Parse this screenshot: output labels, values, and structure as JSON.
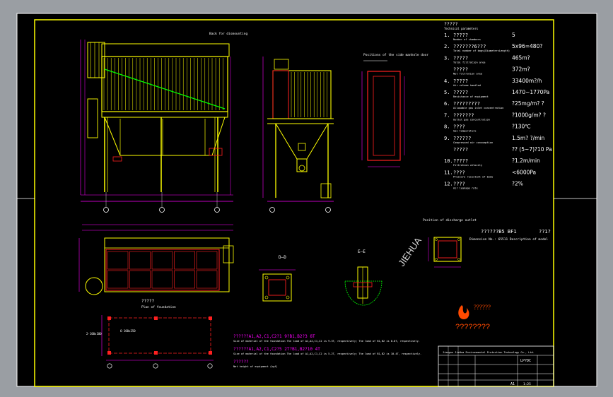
{
  "spec_title": "?????",
  "spec_sub": "Technical parameters",
  "params": [
    {
      "num": "1.",
      "label": "?????",
      "sub": "Number of chambers",
      "value": "5"
    },
    {
      "num": "2.",
      "label": "???????6???",
      "sub": "Total number of bags(Diameter×Length)",
      "value": "5x96=480?"
    },
    {
      "num": "3.",
      "label": "?????",
      "sub": "Total filtration area",
      "value": "465m?"
    },
    {
      "num": "",
      "label": "?????",
      "sub": "Net filtration area",
      "value": "372m?"
    },
    {
      "num": "4.",
      "label": "?????",
      "sub": "Air volume handled",
      "value": "33400m?/h"
    },
    {
      "num": "5.",
      "label": "?????",
      "sub": "Resistance of equipment",
      "value": "1470~1770Pa"
    },
    {
      "num": "6.",
      "label": "?????????",
      "sub": "Allowable gas inlet concentration",
      "value": "?25mg/m? ?"
    },
    {
      "num": "7.",
      "label": "???????",
      "sub": "Outlet gas concentration",
      "value": "?1000g/m? ?"
    },
    {
      "num": "8.",
      "label": "????",
      "sub": "Gas temperature",
      "value": "?130℃"
    },
    {
      "num": "9.",
      "label": "??????",
      "sub": "Compressed air consumption",
      "value": "1.5m? ?/min"
    },
    {
      "num": "",
      "label": "?????",
      "sub": "",
      "value": "??    (5~7)?10   Pa"
    },
    {
      "num": "10.",
      "label": "?????",
      "sub": "Filtration velocity",
      "value": "?1.2m/min"
    },
    {
      "num": "11.",
      "label": "????",
      "sub": "Pressure resistant of body",
      "value": "<6000Pa"
    },
    {
      "num": "12.",
      "label": "????",
      "sub": "Air leakage rate",
      "value": "?2%"
    }
  ],
  "top_label": "Back  for  dismounting",
  "side_label": "Positions of the side manhole door",
  "plan_label": "?????",
  "plan_sub": "Plan of foundation",
  "discharge_label": "Position of discharge outlet",
  "view_label_dd": "D–D",
  "view_label_ee": "E–E",
  "watermark": "JIEHUA",
  "model_line": "??????B5 BF1",
  "model_line2": "Dimension No.: 65511     Description of model",
  "model_right": "??1?",
  "note1": "??????A1,A2,C1,C2?1 9?B1,B2?3 8T",
  "note1_sub": "Size of material of the foundation  The load of A1,A2,C1,C2 is 9.3T, respectively; The load of B1,B2 is 8.8T, respectively.",
  "note2": "??????A1,A2,C1,C2?5 2T?B1,B2?10 4T",
  "note2_sub": "Size of material of the foundation  The load of A1,A2,C1,C2 is 5.2T, respectively; The load of B1,B2 is 10.4T, respectively.",
  "note3": "??????",
  "note3_sub": "Net height of equipment (kgf)",
  "company_cn": "??????",
  "company_en": "????????",
  "tb_company": "Jiangsu JieHua Environmental Protection Technology Co., Ltd.",
  "tb_code": "LP?DC",
  "tb_sheet": "A1",
  "tb_scale": "1:25",
  "brand_color": "#ff4a00",
  "accent_colors": {
    "drawing_yellow": "#ffff00",
    "magenta": "#ff00ff",
    "green": "#00ff00",
    "red": "#ff2020",
    "cyan": "#00ffff"
  }
}
